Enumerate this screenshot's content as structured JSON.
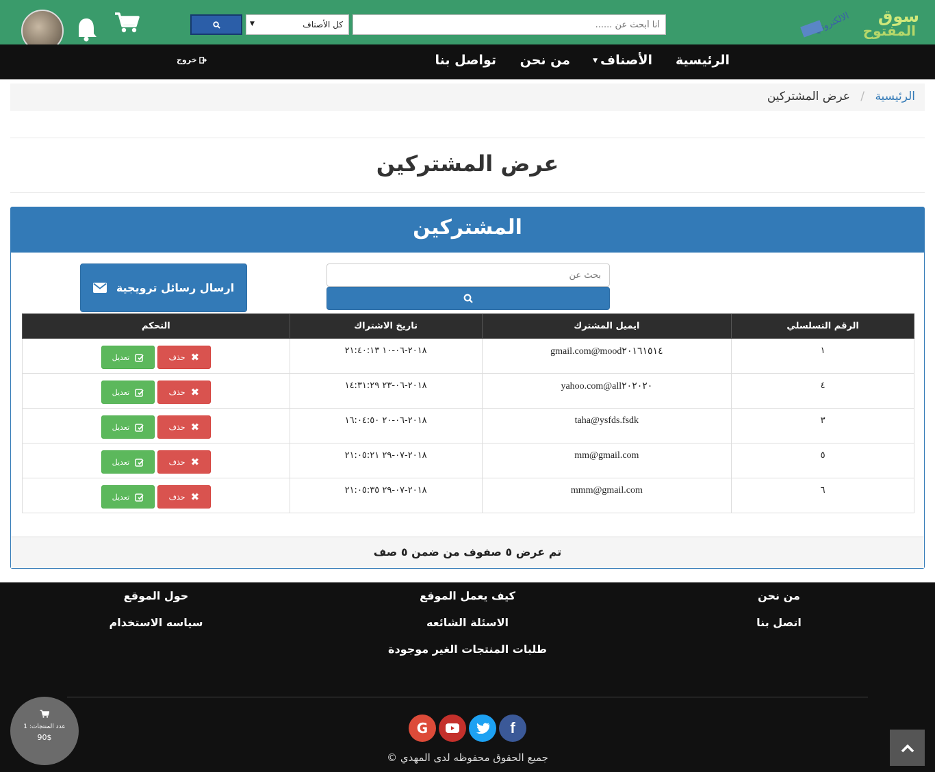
{
  "header": {
    "search_placeholder": "أنا أبحث عن ......",
    "category_selected": "كل الأصناف",
    "logo_alt": "سوق المفتوح الالكتروني"
  },
  "nav": {
    "home": "الرئيسية",
    "categories": "الأصناف",
    "about": "من نحن",
    "contact": "تواصل بنا",
    "logout": "خروج"
  },
  "breadcrumb": {
    "home": "الرئيسية",
    "separator": "/",
    "current": "عرض المشتركين"
  },
  "page": {
    "title": "عرض المشتركين"
  },
  "panel": {
    "heading": "المشتركين",
    "search_placeholder": "بحث عن",
    "promo_button": "ارسال رسائل ترويجية",
    "footer_text": "تم عرض ٥ صفوف من ضمن ٥ صف"
  },
  "table": {
    "headers": [
      "الرقم التسلسلي",
      "ايميل المشترك",
      "تاريخ الاشتراك",
      "التحكم"
    ],
    "edit_label": "تعديل",
    "delete_label": "حذف",
    "rows": [
      {
        "id": "١",
        "email": "mood٢٠١٦١٥١٤@gmail.com",
        "date": "٢٠١٨-٠٦-١٠ ٢١:٤٠:١٣"
      },
      {
        "id": "٤",
        "email": "all٢٠٢٠٢٠@yahoo.com",
        "date": "٢٠١٨-٠٦-٢٣ ١٤:٣١:٢٩"
      },
      {
        "id": "٣",
        "email": "taha@ysfds.fsdk",
        "date": "٢٠١٨-٠٦-٢٠ ١٦:٠٤:٥٠"
      },
      {
        "id": "٥",
        "email": "mm@gmail.com",
        "date": "٢٠١٨-٠٧-٢٩ ٢١:٠٥:٢١"
      },
      {
        "id": "٦",
        "email": "mmm@gmail.com",
        "date": "٢٠١٨-٠٧-٢٩ ٢١:٠٥:٣٥"
      }
    ]
  },
  "footer": {
    "about_us": "من نحن",
    "contact_us": "اتصل بنا",
    "how_it_works": "كيف يعمل الموقع",
    "faq": "الاسئلة الشائعه",
    "missing_requests": "طلبات المنتجات الغير موجودة",
    "about_site": "حول الموقع",
    "usage_policy": "سياسه الاستخدام",
    "copyright": "جميع الحقوق محفوظه لدى المهدي ©"
  },
  "mini_cart": {
    "count_label": "عدد المنتجات: 1",
    "total": "90$"
  },
  "colors": {
    "green": "#3a9b6b",
    "primary": "#337ab7",
    "danger": "#d9534f",
    "success": "#5cb85c",
    "dark": "#111111"
  },
  "icons": [
    "search-icon",
    "cart-icon",
    "bell-icon",
    "envelope-icon",
    "edit-icon",
    "close-icon",
    "logout-icon",
    "arrow-up-icon",
    "google-icon",
    "youtube-icon",
    "twitter-icon",
    "facebook-icon"
  ]
}
